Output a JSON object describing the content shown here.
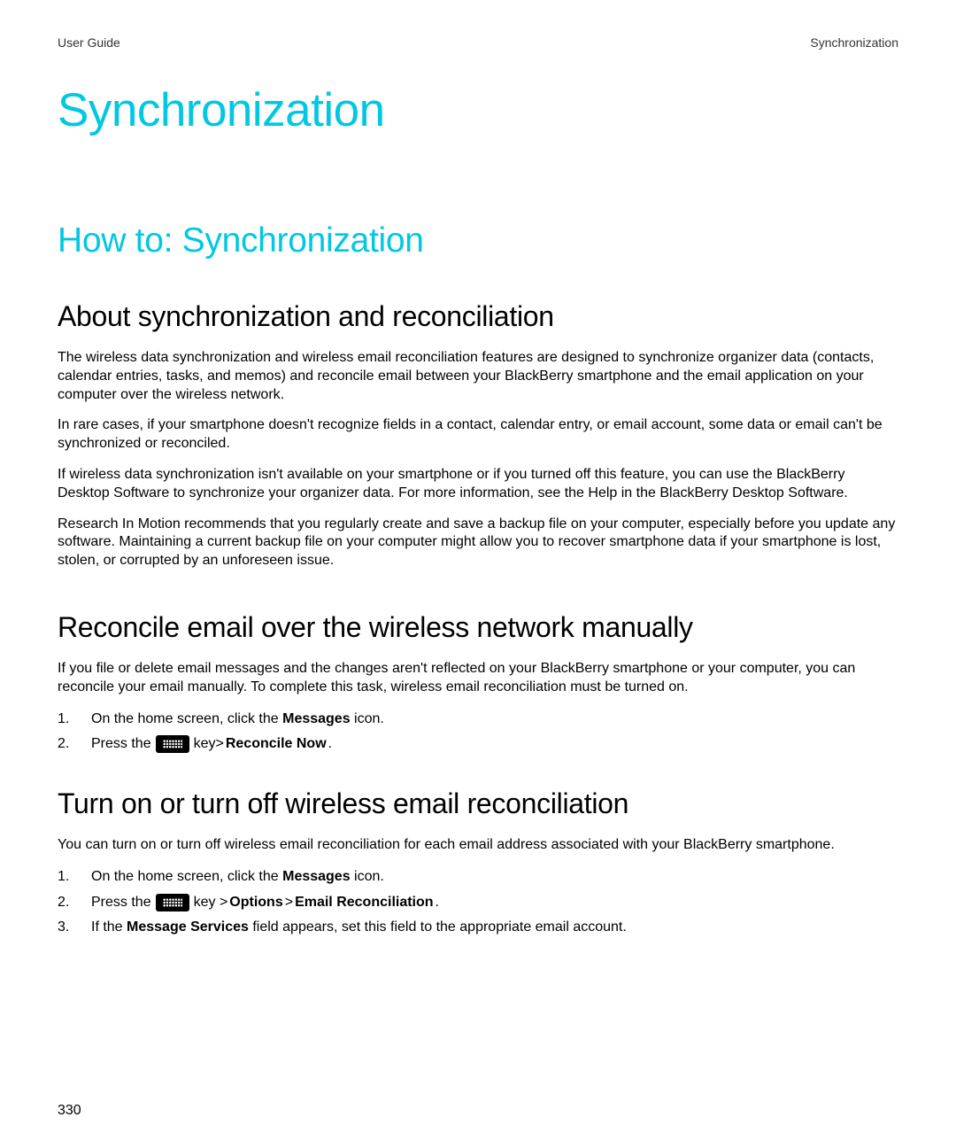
{
  "header": {
    "left": "User Guide",
    "right": "Synchronization"
  },
  "title": "Synchronization",
  "section_h2": "How to: Synchronization",
  "about": {
    "heading": "About synchronization and reconciliation",
    "p1": "The wireless data synchronization and wireless email reconciliation features are designed to synchronize organizer data (contacts, calendar entries, tasks, and memos) and reconcile email between your BlackBerry smartphone and the email application on your computer over the wireless network.",
    "p2": "In rare cases, if your smartphone doesn't recognize fields in a contact, calendar entry, or email account, some data or email can't be synchronized or reconciled.",
    "p3": "If wireless data synchronization isn't available on your smartphone or if you turned off this feature, you can use the BlackBerry Desktop Software to synchronize your organizer data. For more information, see the Help in the BlackBerry Desktop Software.",
    "p4": "Research In Motion recommends that you regularly create and save a backup file on your computer, especially before you update any software. Maintaining a current backup file on your computer might allow you to recover smartphone data if your smartphone is lost, stolen, or corrupted by an unforeseen issue."
  },
  "reconcile": {
    "heading": "Reconcile email over the wireless network manually",
    "intro": "If you file or delete email messages and the changes aren't reflected on your BlackBerry smartphone or your computer, you can reconcile your email manually. To complete this task, wireless email reconciliation must be turned on.",
    "step1_pre": "On the home screen, click the ",
    "step1_bold": "Messages",
    "step1_post": " icon.",
    "step2_pre": "Press the ",
    "step2_mid": " key> ",
    "step2_bold": "Reconcile Now",
    "step2_post": "."
  },
  "turnon": {
    "heading": "Turn on or turn off wireless email reconciliation",
    "intro": "You can turn on or turn off wireless email reconciliation for each email address associated with your BlackBerry smartphone.",
    "step1_pre": "On the home screen, click the ",
    "step1_bold": "Messages",
    "step1_post": " icon.",
    "step2_pre": "Press the ",
    "step2_mid": " key > ",
    "step2_bold1": "Options",
    "step2_gt": " > ",
    "step2_bold2": "Email Reconciliation",
    "step2_post": ".",
    "step3_pre": "If the ",
    "step3_bold": "Message Services",
    "step3_post": " field appears, set this field to the appropriate email account."
  },
  "page_number": "330"
}
